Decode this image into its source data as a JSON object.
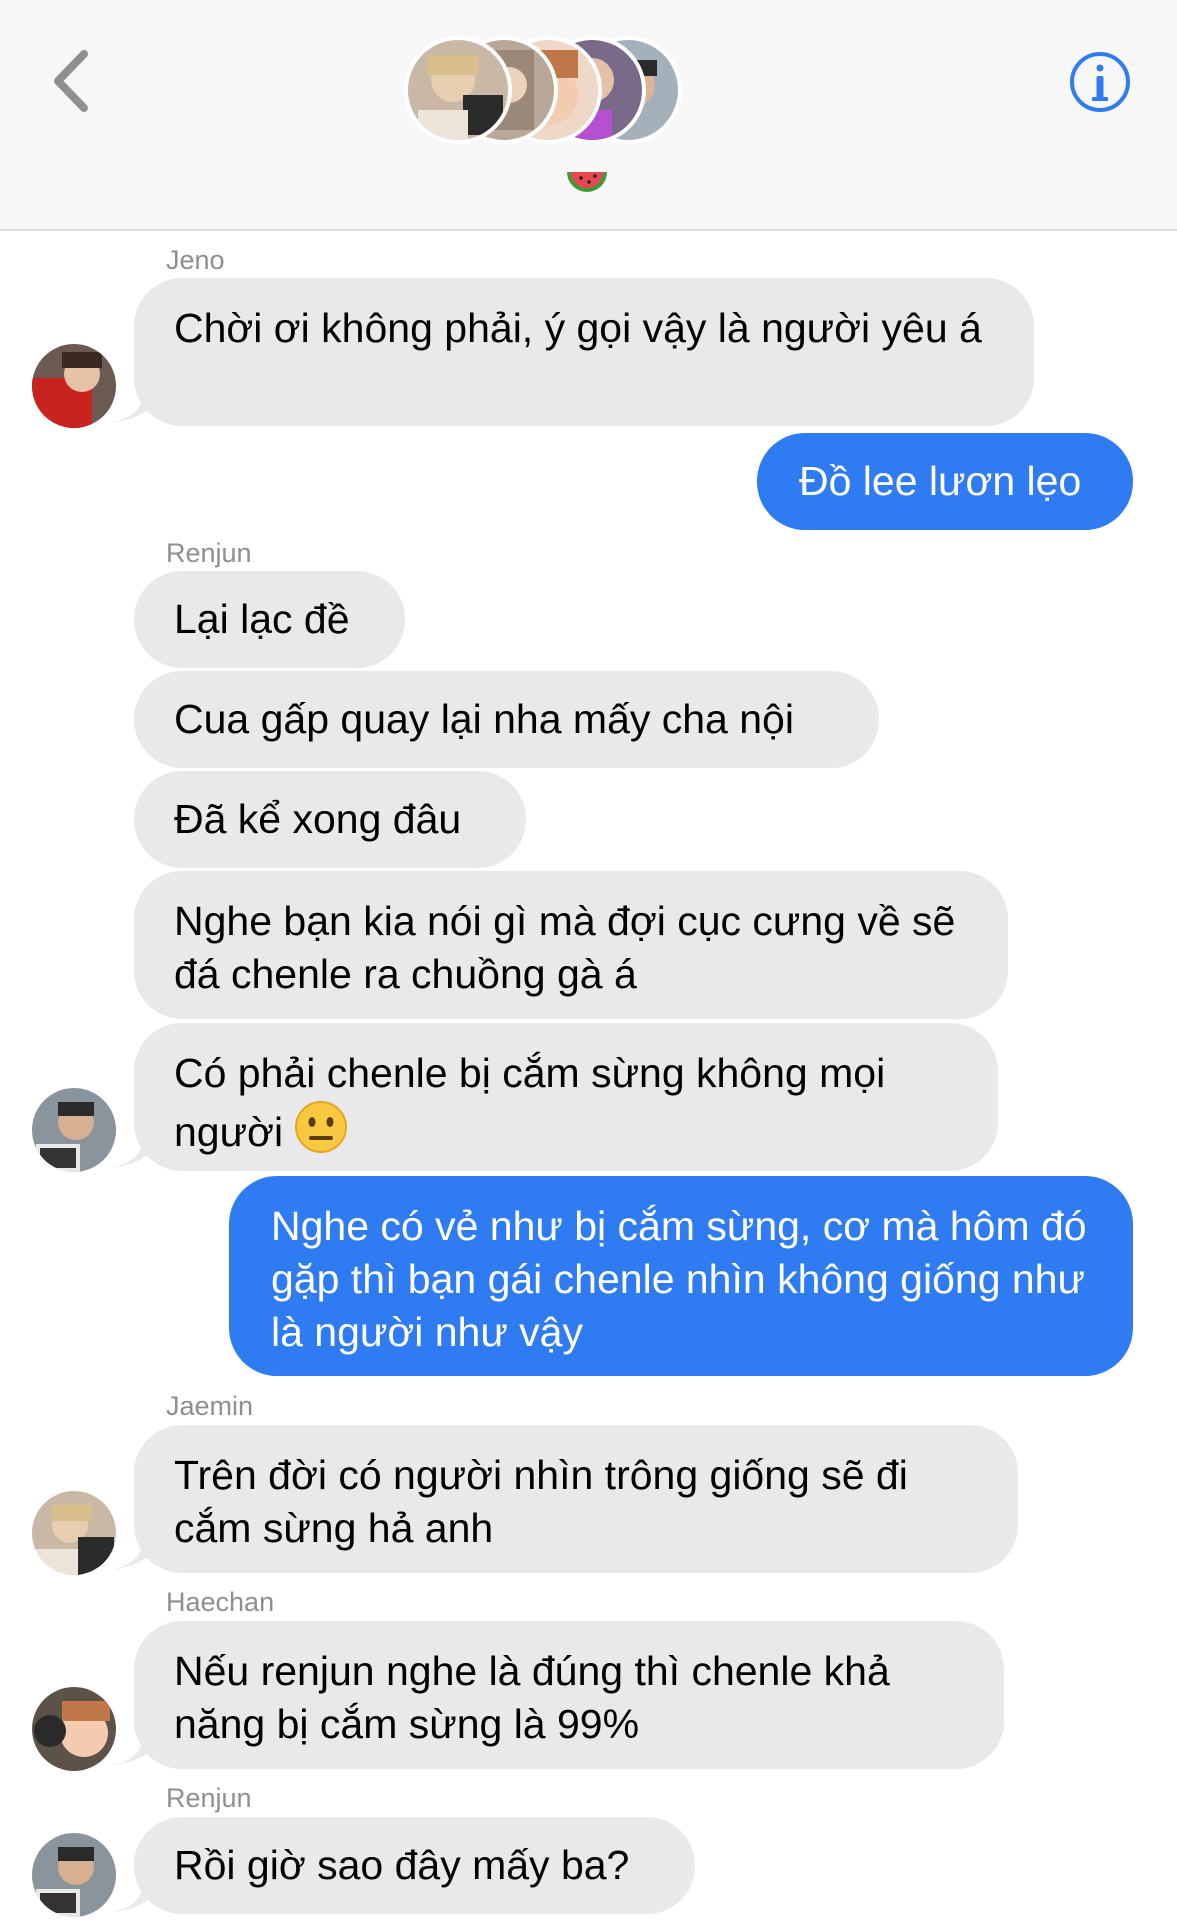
{
  "header": {
    "back_icon": "chevron-left-icon",
    "info_icon": "info-circle-icon",
    "group_emoji": "watermelon",
    "accent": "#2f7bf2"
  },
  "messages": [
    {
      "sender": "Jeno",
      "text": "Chời ơi không phải, ý gọi vậy là người yêu á"
    },
    {
      "text": "Đồ lee lươn lẹo"
    },
    {
      "sender": "Renjun",
      "text": "Lại lạc đề"
    },
    {
      "text": "Cua gấp quay lại nha mấy cha nội"
    },
    {
      "text": "Đã kể xong đâu"
    },
    {
      "text": "Nghe bạn kia nói gì mà đợi cục cưng về sẽ đá chenle ra chuồng gà á"
    },
    {
      "text": "Có phải chenle bị cắm sừng không mọi người"
    },
    {
      "text": "Nghe có vẻ như bị cắm sừng, cơ mà hôm đó gặp thì bạn gái chenle nhìn không giống như là người như vậy"
    },
    {
      "sender": "Jaemin",
      "text": "Trên đời có người nhìn trông giống sẽ đi cắm sừng hả anh"
    },
    {
      "sender": "Haechan",
      "text": "Nếu renjun nghe là đúng thì chenle khả năng bị cắm sừng là 99%"
    },
    {
      "sender": "Renjun",
      "text": "Rồi giờ sao đây mấy ba?"
    }
  ],
  "colors": {
    "incoming_bubble": "#e9e9eb",
    "outgoing_bubble": "#2f7bf2",
    "sender_label": "#8e8e93"
  }
}
